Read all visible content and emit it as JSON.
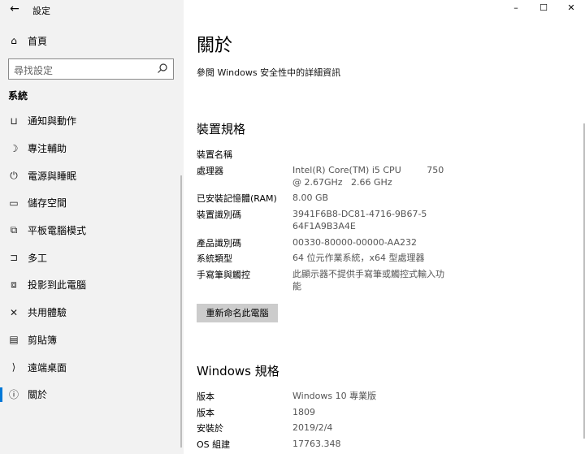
{
  "window": {
    "title": "設定",
    "controls": [
      "–",
      "☐",
      "✕"
    ]
  },
  "sidebar": {
    "home_label": "首頁",
    "search_placeholder": "尋找設定",
    "section": "系統",
    "items": [
      {
        "label": "通知與動作",
        "icon": "notification-icon",
        "glyph": "⊔"
      },
      {
        "label": "專注輔助",
        "icon": "moon-icon",
        "glyph": "☽"
      },
      {
        "label": "電源與睡眠",
        "icon": "power-icon",
        "glyph": "⏻"
      },
      {
        "label": "儲存空間",
        "icon": "storage-icon",
        "glyph": "▭"
      },
      {
        "label": "平板電腦模式",
        "icon": "tablet-icon",
        "glyph": "⧉"
      },
      {
        "label": "多工",
        "icon": "multitask-icon",
        "glyph": "⊐"
      },
      {
        "label": "投影到此電腦",
        "icon": "project-icon",
        "glyph": "⧈"
      },
      {
        "label": "共用體驗",
        "icon": "shared-icon",
        "glyph": "✕"
      },
      {
        "label": "剪貼簿",
        "icon": "clipboard-icon",
        "glyph": "▤"
      },
      {
        "label": "遠端桌面",
        "icon": "remote-icon",
        "glyph": "⟩"
      },
      {
        "label": "關於",
        "icon": "info-icon",
        "glyph": "ⓘ"
      }
    ]
  },
  "main": {
    "title": "關於",
    "security_link": "參閱 Windows 安全性中的詳細資訊",
    "device_heading": "裝置規格",
    "device_specs": [
      {
        "key": "裝置名稱",
        "value": ""
      },
      {
        "key": "處理器",
        "value": "Intel(R) Core(TM) i5 CPU         750  @ 2.67GHz   2.66 GHz"
      },
      {
        "key": "已安裝記憶體(RAM)",
        "value": "8.00 GB"
      },
      {
        "key": "裝置識別碼",
        "value": "3941F6B8-DC81-4716-9B67-564F1A9B3A4E"
      },
      {
        "key": "產品識別碼",
        "value": "00330-80000-00000-AA232"
      },
      {
        "key": "系統類型",
        "value": "64 位元作業系統，x64 型處理器"
      },
      {
        "key": "手寫筆與觸控",
        "value": "此顯示器不提供手寫筆或觸控式輸入功能"
      }
    ],
    "rename_button": "重新命名此電腦",
    "windows_heading": "Windows 規格",
    "windows_specs": [
      {
        "key": "版本",
        "value": "Windows 10 專業版"
      },
      {
        "key": "版本",
        "value": "1809"
      },
      {
        "key": "安裝於",
        "value": "2019/2/4"
      },
      {
        "key": "OS 組建",
        "value": "17763.348"
      }
    ]
  }
}
